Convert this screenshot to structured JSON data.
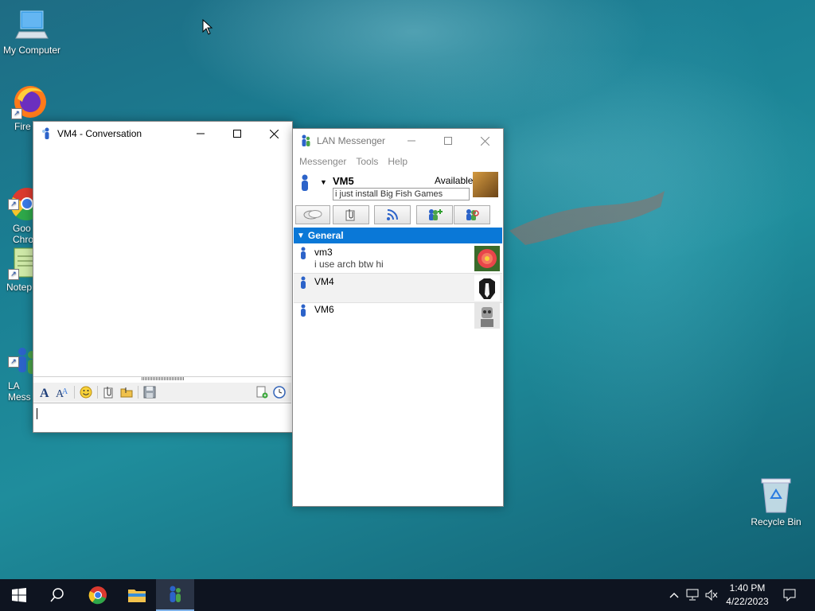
{
  "desktop": {
    "icons": [
      {
        "label": "My Computer"
      },
      {
        "label": "Fire"
      },
      {
        "label": "Goo\nChro"
      },
      {
        "label": "Notep"
      },
      {
        "label": "LA\nMess"
      }
    ],
    "recycle_bin": "Recycle Bin"
  },
  "conversation": {
    "title": "VM4 - Conversation"
  },
  "messenger": {
    "title": "LAN Messenger",
    "menu": [
      "Messenger",
      "Tools",
      "Help"
    ],
    "user": {
      "name": "VM5",
      "status": "Available",
      "note": "i just install Big Fish Games"
    },
    "group": "General",
    "contacts": [
      {
        "name": "vm3",
        "note": "i use arch btw hi"
      },
      {
        "name": "VM4",
        "note": ""
      },
      {
        "name": "VM6",
        "note": ""
      }
    ]
  },
  "taskbar": {
    "time": "1:40 PM",
    "date": "4/22/2023"
  },
  "colors": {
    "accent": "#0a78d7",
    "taskbar": "#0e1420"
  }
}
